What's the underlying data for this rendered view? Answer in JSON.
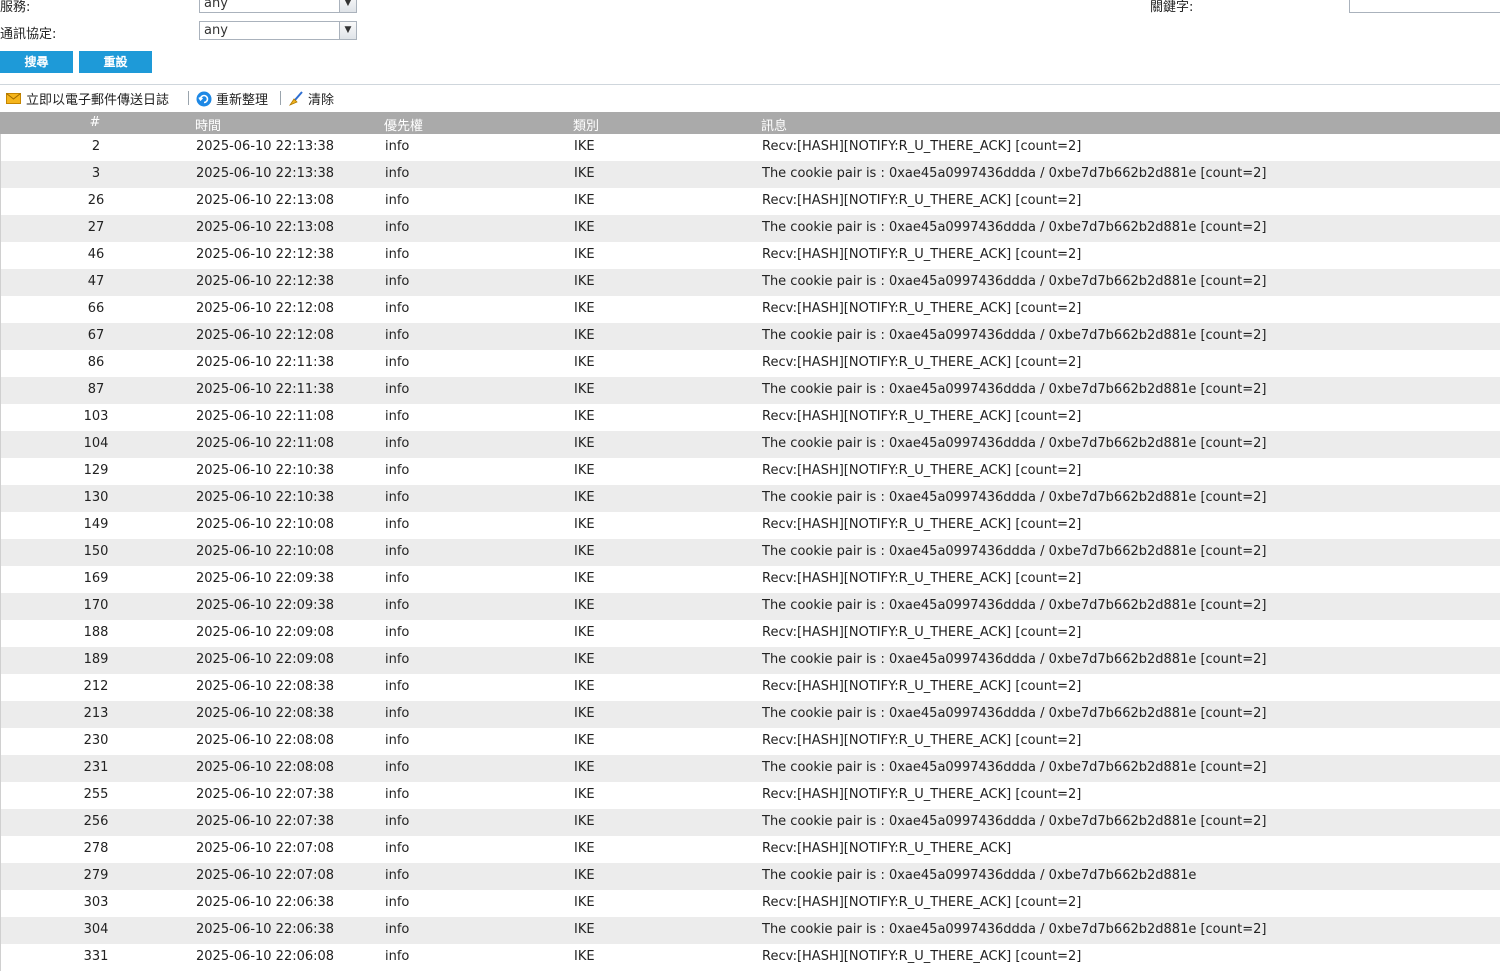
{
  "filters": {
    "service_label": "服務:",
    "service_value": "any",
    "protocol_label": "通訊協定:",
    "protocol_value": "any",
    "keyword_label": "關鍵字:"
  },
  "buttons": {
    "search": "搜尋",
    "reset": "重設"
  },
  "toolbar": {
    "email": "立即以電子郵件傳送日誌",
    "refresh": "重新整理",
    "clear": "清除"
  },
  "columns": {
    "num": "#",
    "time": "時間",
    "priority": "優先權",
    "category": "類別",
    "message": "訊息"
  },
  "rows": [
    {
      "num": "2",
      "time": "2025-06-10 22:13:38",
      "priority": "info",
      "category": "IKE",
      "message": "Recv:[HASH][NOTIFY:R_U_THERE_ACK] [count=2]"
    },
    {
      "num": "3",
      "time": "2025-06-10 22:13:38",
      "priority": "info",
      "category": "IKE",
      "message": "The cookie pair is : 0xae45a0997436ddda / 0xbe7d7b662b2d881e [count=2]"
    },
    {
      "num": "26",
      "time": "2025-06-10 22:13:08",
      "priority": "info",
      "category": "IKE",
      "message": "Recv:[HASH][NOTIFY:R_U_THERE_ACK] [count=2]"
    },
    {
      "num": "27",
      "time": "2025-06-10 22:13:08",
      "priority": "info",
      "category": "IKE",
      "message": "The cookie pair is : 0xae45a0997436ddda / 0xbe7d7b662b2d881e [count=2]"
    },
    {
      "num": "46",
      "time": "2025-06-10 22:12:38",
      "priority": "info",
      "category": "IKE",
      "message": "Recv:[HASH][NOTIFY:R_U_THERE_ACK] [count=2]"
    },
    {
      "num": "47",
      "time": "2025-06-10 22:12:38",
      "priority": "info",
      "category": "IKE",
      "message": "The cookie pair is : 0xae45a0997436ddda / 0xbe7d7b662b2d881e [count=2]"
    },
    {
      "num": "66",
      "time": "2025-06-10 22:12:08",
      "priority": "info",
      "category": "IKE",
      "message": "Recv:[HASH][NOTIFY:R_U_THERE_ACK] [count=2]"
    },
    {
      "num": "67",
      "time": "2025-06-10 22:12:08",
      "priority": "info",
      "category": "IKE",
      "message": "The cookie pair is : 0xae45a0997436ddda / 0xbe7d7b662b2d881e [count=2]"
    },
    {
      "num": "86",
      "time": "2025-06-10 22:11:38",
      "priority": "info",
      "category": "IKE",
      "message": "Recv:[HASH][NOTIFY:R_U_THERE_ACK] [count=2]"
    },
    {
      "num": "87",
      "time": "2025-06-10 22:11:38",
      "priority": "info",
      "category": "IKE",
      "message": "The cookie pair is : 0xae45a0997436ddda / 0xbe7d7b662b2d881e [count=2]"
    },
    {
      "num": "103",
      "time": "2025-06-10 22:11:08",
      "priority": "info",
      "category": "IKE",
      "message": "Recv:[HASH][NOTIFY:R_U_THERE_ACK] [count=2]"
    },
    {
      "num": "104",
      "time": "2025-06-10 22:11:08",
      "priority": "info",
      "category": "IKE",
      "message": "The cookie pair is : 0xae45a0997436ddda / 0xbe7d7b662b2d881e [count=2]"
    },
    {
      "num": "129",
      "time": "2025-06-10 22:10:38",
      "priority": "info",
      "category": "IKE",
      "message": "Recv:[HASH][NOTIFY:R_U_THERE_ACK] [count=2]"
    },
    {
      "num": "130",
      "time": "2025-06-10 22:10:38",
      "priority": "info",
      "category": "IKE",
      "message": "The cookie pair is : 0xae45a0997436ddda / 0xbe7d7b662b2d881e [count=2]"
    },
    {
      "num": "149",
      "time": "2025-06-10 22:10:08",
      "priority": "info",
      "category": "IKE",
      "message": "Recv:[HASH][NOTIFY:R_U_THERE_ACK] [count=2]"
    },
    {
      "num": "150",
      "time": "2025-06-10 22:10:08",
      "priority": "info",
      "category": "IKE",
      "message": "The cookie pair is : 0xae45a0997436ddda / 0xbe7d7b662b2d881e [count=2]"
    },
    {
      "num": "169",
      "time": "2025-06-10 22:09:38",
      "priority": "info",
      "category": "IKE",
      "message": "Recv:[HASH][NOTIFY:R_U_THERE_ACK] [count=2]"
    },
    {
      "num": "170",
      "time": "2025-06-10 22:09:38",
      "priority": "info",
      "category": "IKE",
      "message": "The cookie pair is : 0xae45a0997436ddda / 0xbe7d7b662b2d881e [count=2]"
    },
    {
      "num": "188",
      "time": "2025-06-10 22:09:08",
      "priority": "info",
      "category": "IKE",
      "message": "Recv:[HASH][NOTIFY:R_U_THERE_ACK] [count=2]"
    },
    {
      "num": "189",
      "time": "2025-06-10 22:09:08",
      "priority": "info",
      "category": "IKE",
      "message": "The cookie pair is : 0xae45a0997436ddda / 0xbe7d7b662b2d881e [count=2]"
    },
    {
      "num": "212",
      "time": "2025-06-10 22:08:38",
      "priority": "info",
      "category": "IKE",
      "message": "Recv:[HASH][NOTIFY:R_U_THERE_ACK] [count=2]"
    },
    {
      "num": "213",
      "time": "2025-06-10 22:08:38",
      "priority": "info",
      "category": "IKE",
      "message": "The cookie pair is : 0xae45a0997436ddda / 0xbe7d7b662b2d881e [count=2]"
    },
    {
      "num": "230",
      "time": "2025-06-10 22:08:08",
      "priority": "info",
      "category": "IKE",
      "message": "Recv:[HASH][NOTIFY:R_U_THERE_ACK] [count=2]"
    },
    {
      "num": "231",
      "time": "2025-06-10 22:08:08",
      "priority": "info",
      "category": "IKE",
      "message": "The cookie pair is : 0xae45a0997436ddda / 0xbe7d7b662b2d881e [count=2]"
    },
    {
      "num": "255",
      "time": "2025-06-10 22:07:38",
      "priority": "info",
      "category": "IKE",
      "message": "Recv:[HASH][NOTIFY:R_U_THERE_ACK] [count=2]"
    },
    {
      "num": "256",
      "time": "2025-06-10 22:07:38",
      "priority": "info",
      "category": "IKE",
      "message": "The cookie pair is : 0xae45a0997436ddda / 0xbe7d7b662b2d881e [count=2]"
    },
    {
      "num": "278",
      "time": "2025-06-10 22:07:08",
      "priority": "info",
      "category": "IKE",
      "message": "Recv:[HASH][NOTIFY:R_U_THERE_ACK]"
    },
    {
      "num": "279",
      "time": "2025-06-10 22:07:08",
      "priority": "info",
      "category": "IKE",
      "message": "The cookie pair is : 0xae45a0997436ddda / 0xbe7d7b662b2d881e"
    },
    {
      "num": "303",
      "time": "2025-06-10 22:06:38",
      "priority": "info",
      "category": "IKE",
      "message": "Recv:[HASH][NOTIFY:R_U_THERE_ACK] [count=2]"
    },
    {
      "num": "304",
      "time": "2025-06-10 22:06:38",
      "priority": "info",
      "category": "IKE",
      "message": "The cookie pair is : 0xae45a0997436ddda / 0xbe7d7b662b2d881e [count=2]"
    },
    {
      "num": "331",
      "time": "2025-06-10 22:06:08",
      "priority": "info",
      "category": "IKE",
      "message": "Recv:[HASH][NOTIFY:R_U_THERE_ACK] [count=2]"
    }
  ]
}
